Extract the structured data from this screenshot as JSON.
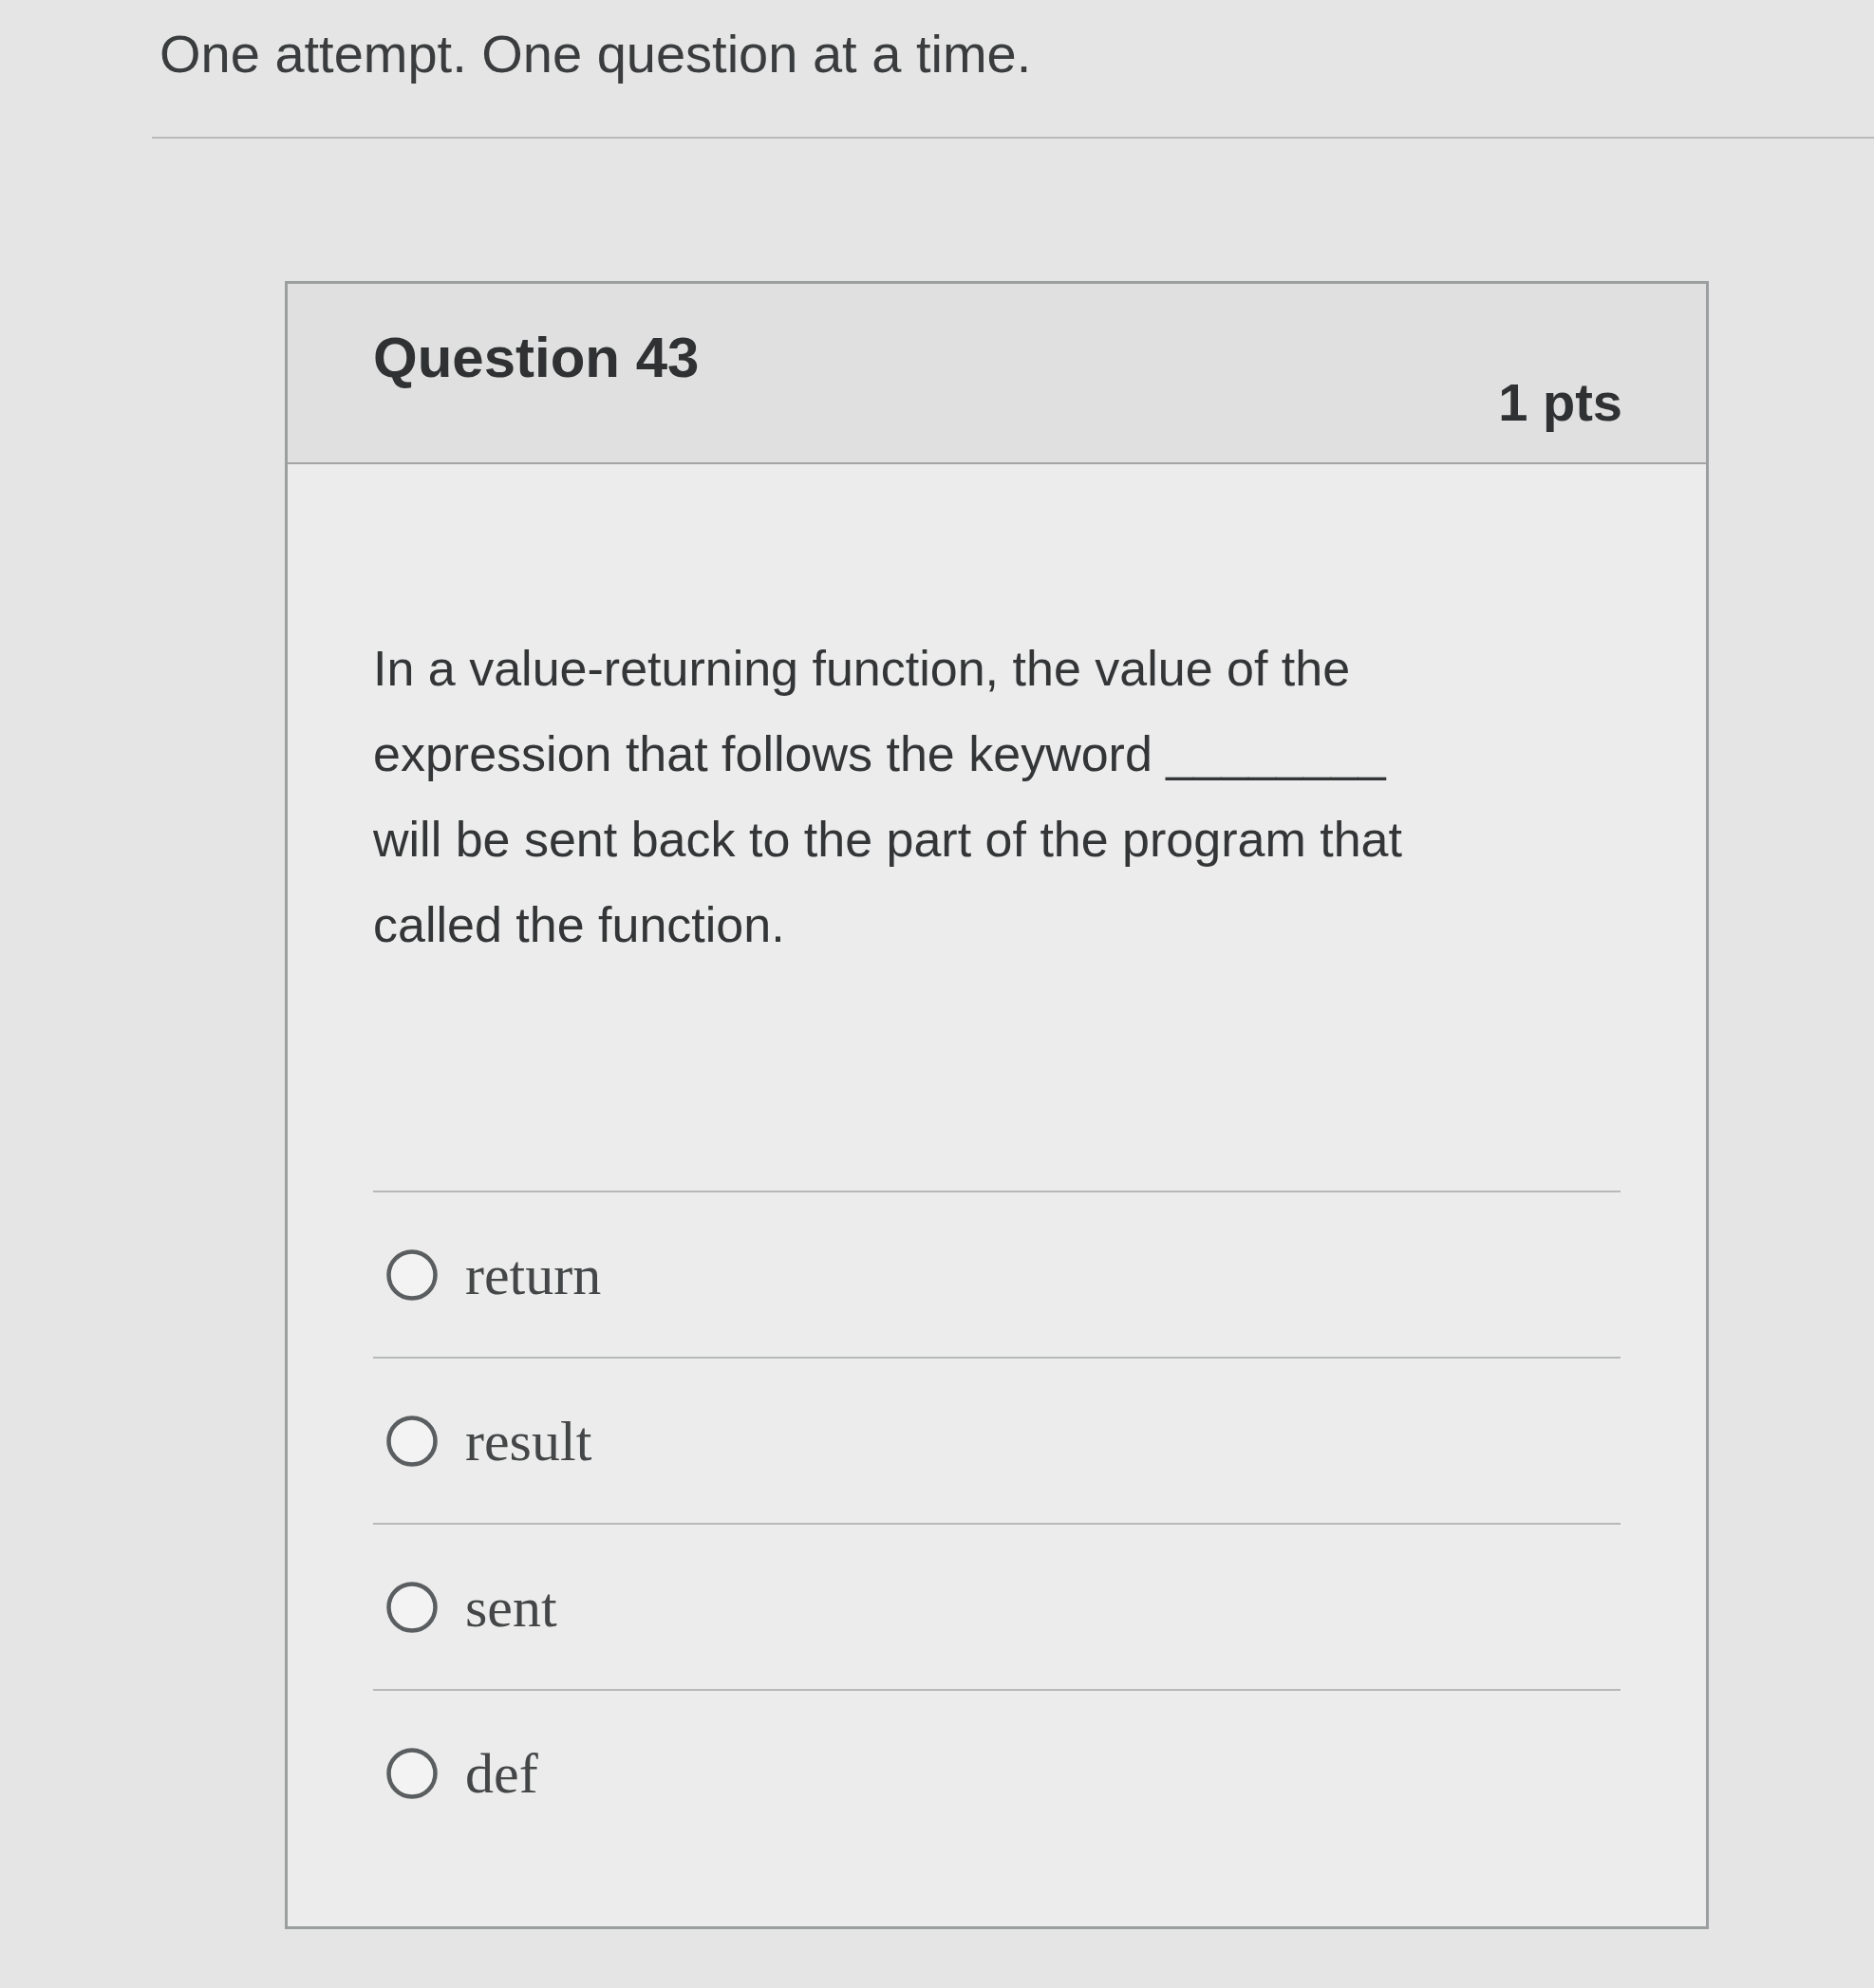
{
  "page_title": "One attempt. One question at a time.",
  "question": {
    "title": "Question 43",
    "points": "1 pts",
    "text": "In a value-returning function, the value of the\nexpression that follows the keyword ________\nwill be sent back to the part of the program that\ncalled the function.",
    "answers": [
      {
        "label": "return",
        "selected": false
      },
      {
        "label": "result",
        "selected": false
      },
      {
        "label": "sent",
        "selected": false
      },
      {
        "label": "def",
        "selected": false
      }
    ]
  }
}
